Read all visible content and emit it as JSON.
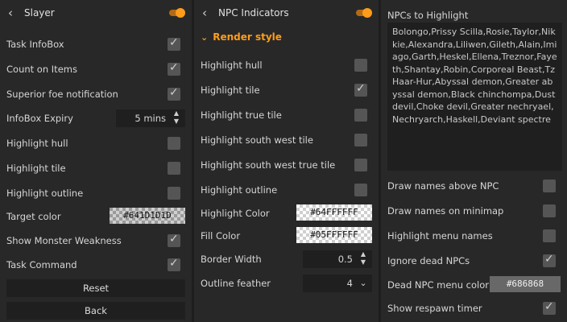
{
  "panel1": {
    "title": "Slayer",
    "rows": [
      {
        "label": "Task InfoBox",
        "checked": true
      },
      {
        "label": "Count on Items",
        "checked": true
      },
      {
        "label": "Superior foe notification",
        "checked": true
      },
      {
        "label": "InfoBox Expiry",
        "spinner": "5 mins"
      },
      {
        "label": "Highlight hull",
        "checked": false
      },
      {
        "label": "Highlight tile",
        "checked": false
      },
      {
        "label": "Highlight outline",
        "checked": false
      },
      {
        "label": "Target color",
        "color": "#641D1D1D"
      },
      {
        "label": "Show Monster Weakness",
        "checked": true
      },
      {
        "label": "Task Command",
        "checked": true
      }
    ],
    "reset_label": "Reset",
    "back_label": "Back"
  },
  "panel2": {
    "title": "NPC Indicators",
    "section": "Render style",
    "rows": [
      {
        "label": "Highlight hull",
        "checked": false
      },
      {
        "label": "Highlight tile",
        "checked": true
      },
      {
        "label": "Highlight true tile",
        "checked": false
      },
      {
        "label": "Highlight south west tile",
        "checked": false
      },
      {
        "label": "Highlight south west true tile",
        "checked": false
      },
      {
        "label": "Highlight outline",
        "checked": false
      },
      {
        "label": "Highlight Color",
        "color": "#64FFFFFF"
      },
      {
        "label": "Fill Color",
        "color": "#05FFFFFF"
      },
      {
        "label": "Border Width",
        "spinner": "0.5"
      },
      {
        "label": "Outline feather",
        "spinner": "4"
      }
    ]
  },
  "panel3": {
    "npcs_label": "NPCs to Highlight",
    "npcs_text": "Bolongo,Prissy Scilla,Rosie,Taylor,Nikkie,Alexandra,Liliwen,Gileth,Alain,Imiago,Garth,Heskel,Ellena,Treznor,Fayeth,Shantay,Robin,Corporeal Beast,TzHaar-Hur,Abyssal demon,Greater abyssal demon,Black chinchompa,Dust devil,Choke devil,Greater nechryael,Nechryarch,Haskell,Deviant spectre",
    "rows": [
      {
        "label": "Draw names above NPC",
        "checked": false
      },
      {
        "label": "Draw names on minimap",
        "checked": false
      },
      {
        "label": "Highlight menu names",
        "checked": false
      },
      {
        "label": "Ignore dead NPCs",
        "checked": true
      },
      {
        "label": "Dead NPC menu color",
        "color": "#686868"
      },
      {
        "label": "Show respawn timer",
        "checked": true
      }
    ]
  },
  "colors": {
    "accent": "#ff9c1a",
    "panel_bg": "#282828",
    "field_bg": "#1f1f1f",
    "checkbox_bg": "#555555"
  }
}
